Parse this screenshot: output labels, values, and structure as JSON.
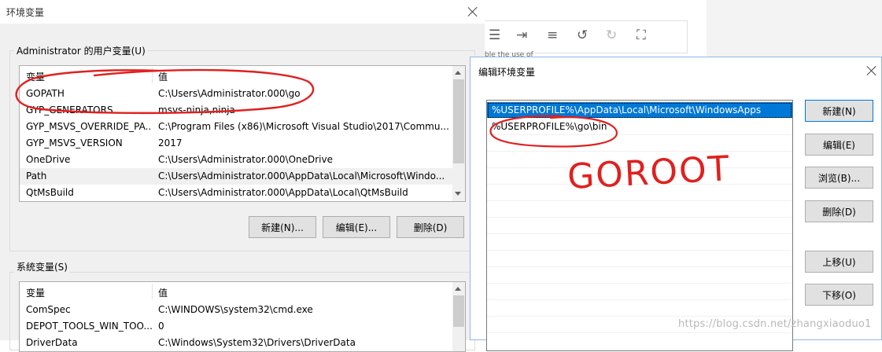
{
  "env_dialog": {
    "title": "环境变量",
    "user_group_label": "Administrator 的用户变量(U)",
    "system_group_label": "系统变量(S)",
    "columns": {
      "variable": "变量",
      "value": "值"
    },
    "user_vars": [
      {
        "name": "GOPATH",
        "value": "C:\\Users\\Administrator.000\\go"
      },
      {
        "name": "GYP_GENERATORS",
        "value": "msvs-ninja,ninja"
      },
      {
        "name": "GYP_MSVS_OVERRIDE_PA...",
        "value": "C:\\Program Files (x86)\\Microsoft Visual Studio\\2017\\Commu..."
      },
      {
        "name": "GYP_MSVS_VERSION",
        "value": "2017"
      },
      {
        "name": "OneDrive",
        "value": "C:\\Users\\Administrator.000\\OneDrive"
      },
      {
        "name": "Path",
        "value": "C:\\Users\\Administrator.000\\AppData\\Local\\Microsoft\\Windo..."
      },
      {
        "name": "QtMsBuild",
        "value": "C:\\Users\\Administrator.000\\AppData\\Local\\QtMsBuild"
      }
    ],
    "system_vars": [
      {
        "name": "ComSpec",
        "value": "C:\\WINDOWS\\system32\\cmd.exe"
      },
      {
        "name": "DEPOT_TOOLS_WIN_TOO...",
        "value": "0"
      },
      {
        "name": "DriverData",
        "value": "C:\\Windows\\System32\\Drivers\\DriverData"
      }
    ],
    "buttons": {
      "new": "新建(N)...",
      "edit": "编辑(E)...",
      "delete": "删除(D)"
    }
  },
  "bg_editor": {
    "snippet": "ble the use of"
  },
  "edit_dialog": {
    "title": "编辑环境变量",
    "entries": [
      "%USERPROFILE%\\AppData\\Local\\Microsoft\\WindowsApps",
      "%USERPROFILE%\\go\\bin"
    ],
    "buttons": {
      "new": "新建(N)",
      "edit": "编辑(E)",
      "browse": "浏览(B)...",
      "delete": "删除(D)",
      "move_up": "上移(U)",
      "move_down": "下移(O)"
    }
  },
  "annotation": {
    "handwritten_text": "GOROOT"
  },
  "watermark": "https://blog.csdn.net/zhangxiaoduo1",
  "colors": {
    "selection": "#0078d7",
    "annotation_red": "#e0201e",
    "dialog_bg": "#f0f0f0"
  }
}
